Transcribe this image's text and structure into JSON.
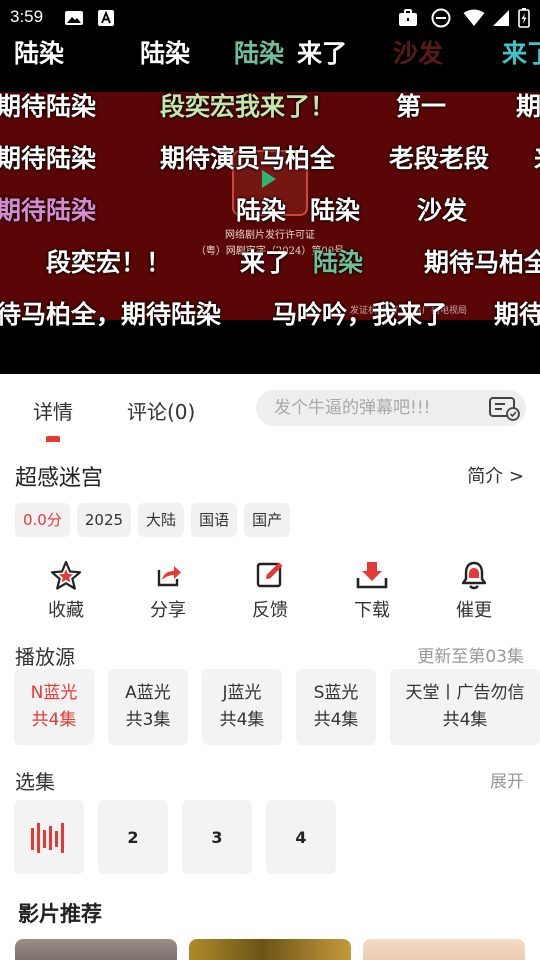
{
  "status_bar": {
    "time": "3:59"
  },
  "video": {
    "license_line1": "网络剧片发行许可证",
    "license_line2": "（粤）网剧审字（2024）第00号",
    "license_line3": "发证机关：广东省广播电视局",
    "danmaku": [
      {
        "text": "陆染",
        "color": "#ffffff"
      },
      {
        "text": "陆染",
        "color": "#ffffff"
      },
      {
        "text": "陆染",
        "color": "#6fbf9a"
      },
      {
        "text": "来了",
        "color": "#ffffff"
      },
      {
        "text": "沙发",
        "color": "#5a1a1a"
      },
      {
        "text": "来了",
        "color": "#3ec6c8"
      },
      {
        "text": "期待陆染",
        "color": "#ffffff"
      },
      {
        "text": "段奕宏我来了！",
        "color": "#c6e6a8"
      },
      {
        "text": "第一",
        "color": "#ffffff"
      },
      {
        "text": "期",
        "color": "#ffffff"
      },
      {
        "text": "期待陆染",
        "color": "#ffffff"
      },
      {
        "text": "期待演员马柏全",
        "color": "#ffffff"
      },
      {
        "text": "老段老段",
        "color": "#ffffff"
      },
      {
        "text": "来",
        "color": "#ffffff"
      },
      {
        "text": "期待陆染",
        "color": "#d98ad0"
      },
      {
        "text": "陆染",
        "color": "#ffffff"
      },
      {
        "text": "陆染",
        "color": "#ffffff"
      },
      {
        "text": "沙发",
        "color": "#ffffff"
      },
      {
        "text": "段奕宏！！",
        "color": "#ffffff"
      },
      {
        "text": "来了",
        "color": "#ffffff"
      },
      {
        "text": "陆染",
        "color": "#6fbf9a"
      },
      {
        "text": "期待马柏全",
        "color": "#ffffff"
      },
      {
        "text": "待马柏全，期待陆染",
        "color": "#ffffff"
      },
      {
        "text": "马吟吟，我来了",
        "color": "#ffffff"
      },
      {
        "text": "期待",
        "color": "#ffffff"
      }
    ]
  },
  "tabs": [
    {
      "label": "详情"
    },
    {
      "label": "评论(0)"
    }
  ],
  "danmaku_input": {
    "placeholder": "发个牛逼的弹幕吧!!!"
  },
  "detail": {
    "title": "超感迷宫",
    "intro": "简介 >",
    "tags": [
      "0.0分",
      "2025",
      "大陆",
      "国语",
      "国产"
    ],
    "actions": [
      {
        "label": "收藏",
        "icon": "star-icon"
      },
      {
        "label": "分享",
        "icon": "share-icon"
      },
      {
        "label": "反馈",
        "icon": "feedback-icon"
      },
      {
        "label": "下载",
        "icon": "download-icon"
      },
      {
        "label": "催更",
        "icon": "bell-icon"
      }
    ],
    "sources_title": "播放源",
    "sources_update": "更新至第03集",
    "sources": [
      {
        "name": "N蓝光",
        "count": "共4集"
      },
      {
        "name": "A蓝光",
        "count": "共3集"
      },
      {
        "name": "J蓝光",
        "count": "共4集"
      },
      {
        "name": "S蓝光",
        "count": "共4集"
      },
      {
        "name": "天堂丨广告勿信",
        "count": "共4集"
      }
    ],
    "episodes_title": "选集",
    "episodes_expand": "展开",
    "episodes": [
      "2",
      "3",
      "4"
    ],
    "recommend_title": "影片推荐"
  },
  "colors": {
    "accent": "#e53935",
    "poster": "#5a0606"
  }
}
